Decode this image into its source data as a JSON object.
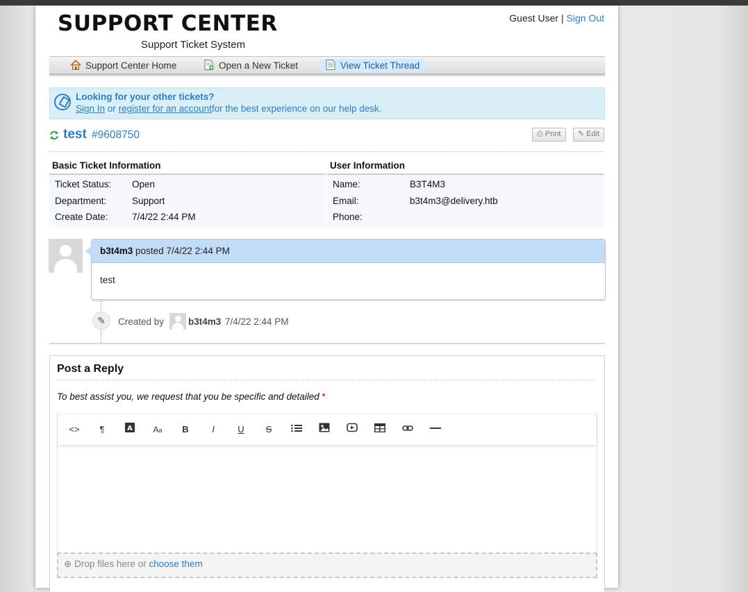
{
  "header": {
    "logo_title": "SUPPORT CENTER",
    "logo_subtitle": "Support Ticket System",
    "guest_label": "Guest User",
    "separator": "|",
    "sign_out": "Sign Out"
  },
  "nav": {
    "items": [
      {
        "label": "Support Center Home",
        "icon": "home-icon"
      },
      {
        "label": "Open a New Ticket",
        "icon": "new-ticket-icon"
      },
      {
        "label": "View Ticket Thread",
        "icon": "ticket-thread-icon",
        "active": true
      }
    ]
  },
  "banner": {
    "title": "Looking for your other tickets?",
    "sign_in": "Sign In",
    "or": "or",
    "register": "register for an account",
    "tail": "for the best experience on our help desk."
  },
  "ticket": {
    "subject": "test",
    "number": "#9608750",
    "print_label": "Print",
    "edit_label": "Edit"
  },
  "basic_info": {
    "heading": "Basic Ticket Information",
    "rows": [
      {
        "key": "Ticket Status:",
        "value": "Open"
      },
      {
        "key": "Department:",
        "value": "Support"
      },
      {
        "key": "Create Date:",
        "value": "7/4/22 2:44 PM"
      }
    ]
  },
  "user_info": {
    "heading": "User Information",
    "rows": [
      {
        "key": "Name:",
        "value": "B3T4M3"
      },
      {
        "key": "Email:",
        "value": "b3t4m3@delivery.htb"
      },
      {
        "key": "Phone:",
        "value": ""
      }
    ]
  },
  "thread": {
    "author": "b3t4m3",
    "posted_word": "posted",
    "posted_date": "7/4/22 2:44 PM",
    "body": "test",
    "event": {
      "created_by": "Created by",
      "user": "b3t4m3",
      "date": "7/4/22 2:44 PM"
    }
  },
  "reply": {
    "title": "Post a Reply",
    "hint": "To best assist you, we request that you be specific and detailed",
    "required_mark": "*",
    "dropzone_text": "Drop files here or",
    "dropzone_link": "choose them",
    "toolbar": [
      "html-code-icon",
      "paragraph-icon",
      "font-color-icon",
      "font-size-icon",
      "bold-icon",
      "italic-icon",
      "underline-icon",
      "strikethrough-icon",
      "list-icon",
      "image-icon",
      "video-icon",
      "table-icon",
      "link-icon",
      "horizontal-rule-icon"
    ]
  },
  "colors": {
    "accent": "#2c7fc4",
    "banner_bg": "#daeef8",
    "entry_header": "#c2dbf7",
    "status_green": "#2aa84a"
  }
}
